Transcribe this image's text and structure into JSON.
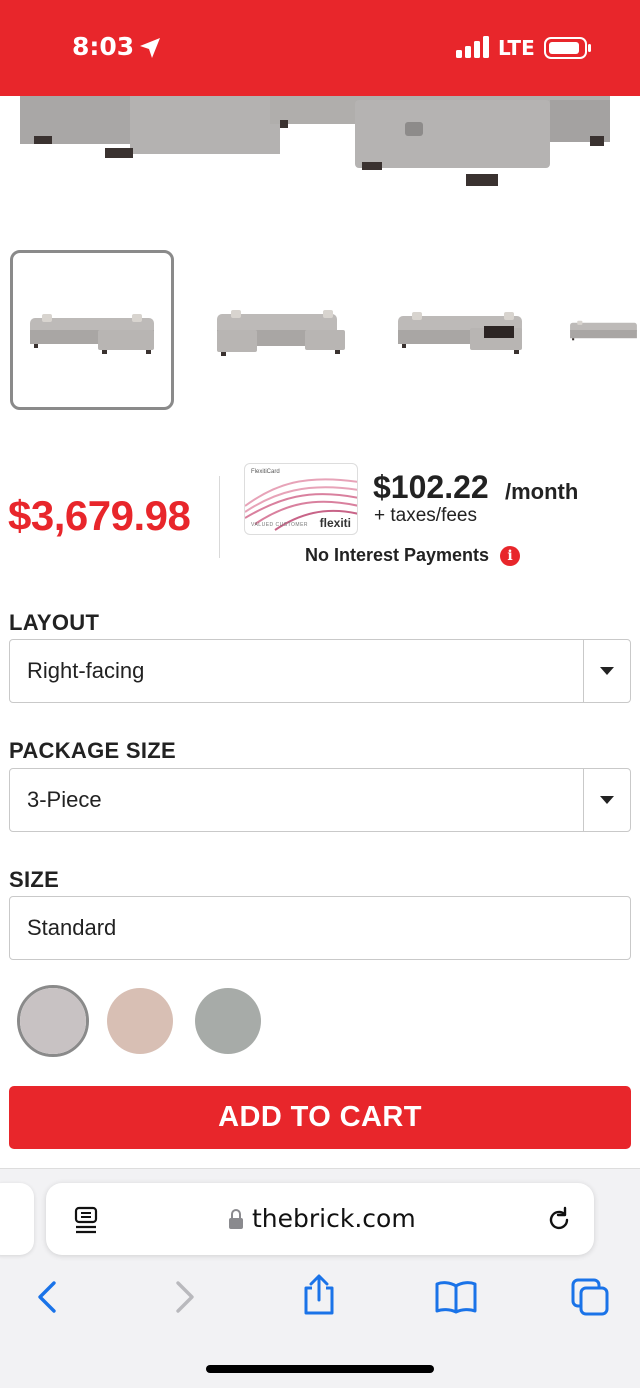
{
  "status_bar": {
    "time": "8:03",
    "network": "LTE",
    "background_color": "#e8262b"
  },
  "product": {
    "price": "$3,679.98",
    "thumbnails": [
      "sectional-left-facing-view",
      "sectional-front-view",
      "sectional-storage-open-view",
      "sectional-side-view"
    ]
  },
  "financing": {
    "card_header": "FlexitiCard",
    "card_brand": "flexiti",
    "card_holder": "VALUED CUSTOMER",
    "monthly_amount": "$102.22",
    "monthly_unit": "/month",
    "fees_note": "+ taxes/fees",
    "no_interest": "No Interest Payments"
  },
  "options": {
    "layout": {
      "label": "LAYOUT",
      "value": "Right-facing"
    },
    "package_size": {
      "label": "PACKAGE SIZE",
      "value": "3-Piece"
    },
    "size": {
      "label": "SIZE",
      "value": "Standard"
    }
  },
  "swatches": [
    {
      "name": "light-grey",
      "color": "#c8c2c3",
      "selected": true
    },
    {
      "name": "beige",
      "color": "#d8bfb4",
      "selected": false
    },
    {
      "name": "grey-green",
      "color": "#a7aba8",
      "selected": false
    }
  ],
  "cart": {
    "label": "ADD TO CART"
  },
  "browser": {
    "url": "thebrick.com"
  },
  "accent_color": "#e8262b"
}
